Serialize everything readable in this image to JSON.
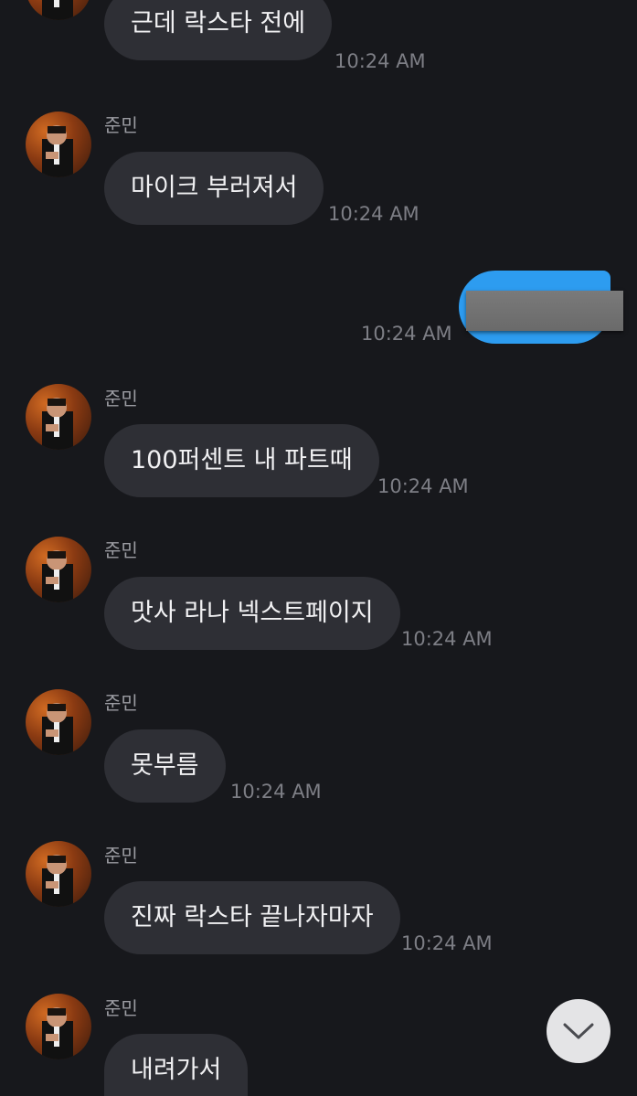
{
  "messages": [
    {
      "sender": "",
      "text": "근데 락스타 전에",
      "time": "10:24 AM"
    },
    {
      "sender": "준민",
      "text": "마이크 부러져서",
      "time": "10:24 AM"
    },
    {
      "sender": "",
      "text": "",
      "time": "10:24 AM",
      "outgoing": true,
      "redacted": true
    },
    {
      "sender": "준민",
      "text": "100퍼센트 내 파트때",
      "time": "10:24 AM"
    },
    {
      "sender": "준민",
      "text": "맛사 라나 넥스트페이지",
      "time": "10:24 AM"
    },
    {
      "sender": "준민",
      "text": "못부름",
      "time": "10:24 AM"
    },
    {
      "sender": "준민",
      "text": "진짜 락스타 끝나자마자",
      "time": "10:24 AM"
    },
    {
      "sender": "준민",
      "text": "내려가서",
      "time": ""
    }
  ],
  "icons": {
    "avatar": "profile-photo-icon",
    "scroll_down": "chevron-down-icon"
  },
  "colors": {
    "background": "#17181c",
    "incoming_bubble": "#2e2f35",
    "outgoing_bubble": "#2d9cf0",
    "timestamp": "#7d7e85",
    "sender_name": "#9b9ca2"
  }
}
